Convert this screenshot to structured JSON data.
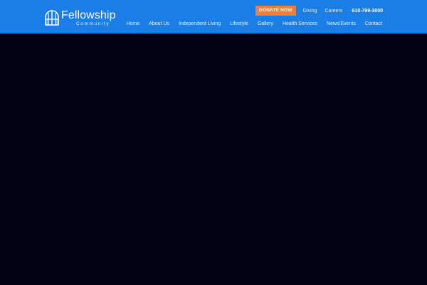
{
  "header": {
    "logo": {
      "name": "Fellowship",
      "sub": "Community"
    },
    "top_links": {
      "donate_label": "DONATE NOW",
      "giving": "Giving",
      "careers": "Careers",
      "phone": "610-799-3000"
    },
    "nav": [
      "Home",
      "About Us",
      "Independent Living",
      "Lifestyle",
      "Gallery",
      "Health Services",
      "News/Events",
      "Contact"
    ]
  },
  "colors": {
    "header_bg": "#1a7ee6",
    "donate_bg": "#ef7e38",
    "hero_bg": "#010214"
  }
}
